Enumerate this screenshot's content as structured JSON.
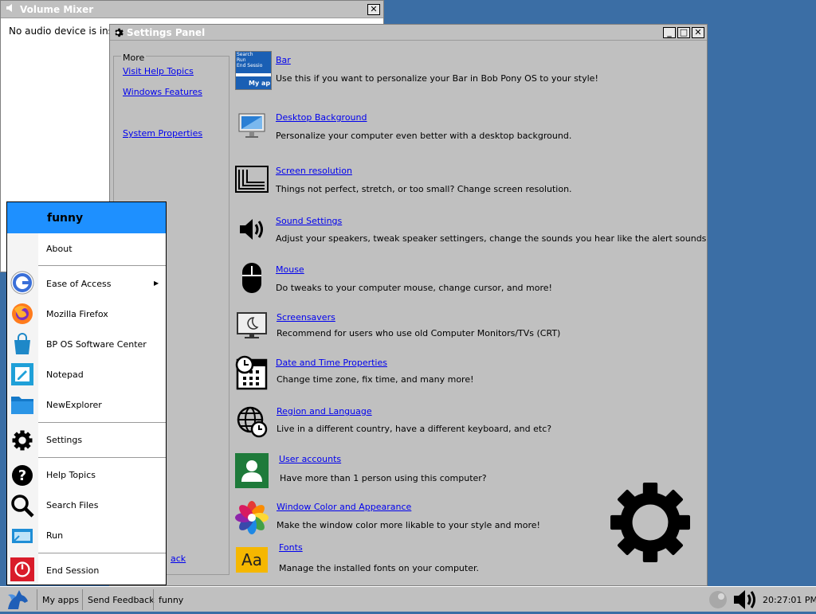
{
  "volume_mixer": {
    "title": "Volume Mixer",
    "close_glyph": "✕",
    "message": "No audio device is insta"
  },
  "settings": {
    "title": "Settings Panel",
    "min_glyph": "_",
    "max_glyph": "□",
    "close_glyph": "✕",
    "more": {
      "label": "More",
      "links": [
        "Visit Help Topics",
        "Windows Features",
        "System Properties"
      ],
      "back_fragment": "ack"
    },
    "items": [
      {
        "title": "Bar",
        "desc": "Use this if you want to personalize your Bar in Bob Pony OS to your style!",
        "icon": "bar-preview-icon"
      },
      {
        "title": "Desktop Background",
        "desc": "Personalize your computer even better with a desktop background.",
        "icon": "desktop-background-icon"
      },
      {
        "title": "Screen resolution",
        "desc": "Things not perfect, stretch, or too small? Change screen resolution.",
        "icon": "screen-resolution-icon"
      },
      {
        "title": "Sound Settings",
        "desc": "Adjust your speakers, tweak speaker settingers, change the sounds you hear like the alert sounds",
        "icon": "speaker-icon"
      },
      {
        "title": "Mouse",
        "desc": "Do tweaks to your computer mouse, change cursor, and more!",
        "icon": "mouse-icon"
      },
      {
        "title": "Screensavers",
        "desc": "Recommend for users who use old Computer Monitors/TVs (CRT)",
        "icon": "screensaver-monitor-icon"
      },
      {
        "title": "Date and Time Properties",
        "desc": "Change time zone, fix time, and many more!",
        "icon": "calendar-clock-icon"
      },
      {
        "title": "Region and Language",
        "desc": "Live in a different country, have a different keyboard, and etc?",
        "icon": "globe-clock-icon"
      },
      {
        "title": "User accounts",
        "desc": "Have more than 1 person using this computer?",
        "icon": "user-account-icon"
      },
      {
        "title": "Window Color and Appearance",
        "desc": "Make the window color more likable to your style and more!",
        "icon": "color-flower-icon"
      },
      {
        "title": "Fonts",
        "desc": "Manage the installed fonts on your computer.",
        "icon": "fonts-icon"
      }
    ],
    "bar_preview": {
      "line1": "Search",
      "line2": "Run",
      "line3": "End Sessio",
      "line4": "My ap"
    }
  },
  "start_menu": {
    "user": "funny",
    "items": [
      {
        "label": "About",
        "icon": ""
      },
      {
        "label": "Ease of Access",
        "icon": "ease-of-access-icon",
        "arrow": "▶"
      },
      {
        "label": "Mozilla Firefox",
        "icon": "firefox-icon"
      },
      {
        "label": "BP OS Software Center",
        "icon": "software-center-bag-icon"
      },
      {
        "label": "Notepad",
        "icon": "notepad-icon"
      },
      {
        "label": "NewExplorer",
        "icon": "folder-icon"
      },
      {
        "label": "Settings",
        "icon": "gear-icon"
      },
      {
        "label": "Help Topics",
        "icon": "help-icon"
      },
      {
        "label": "Search Files",
        "icon": "search-icon"
      },
      {
        "label": "Run",
        "icon": "run-icon"
      },
      {
        "label": "End Session",
        "icon": "power-icon"
      }
    ]
  },
  "taskbar": {
    "my_apps": "My apps",
    "send_feedback": "Send Feedback",
    "user": "funny",
    "clock": "20:27:01 PM"
  },
  "colors": {
    "desktop": "#3b6ea5",
    "start_header": "#1e90ff",
    "window_gray": "#c0c0c0",
    "link_blue": "#0000ee"
  }
}
